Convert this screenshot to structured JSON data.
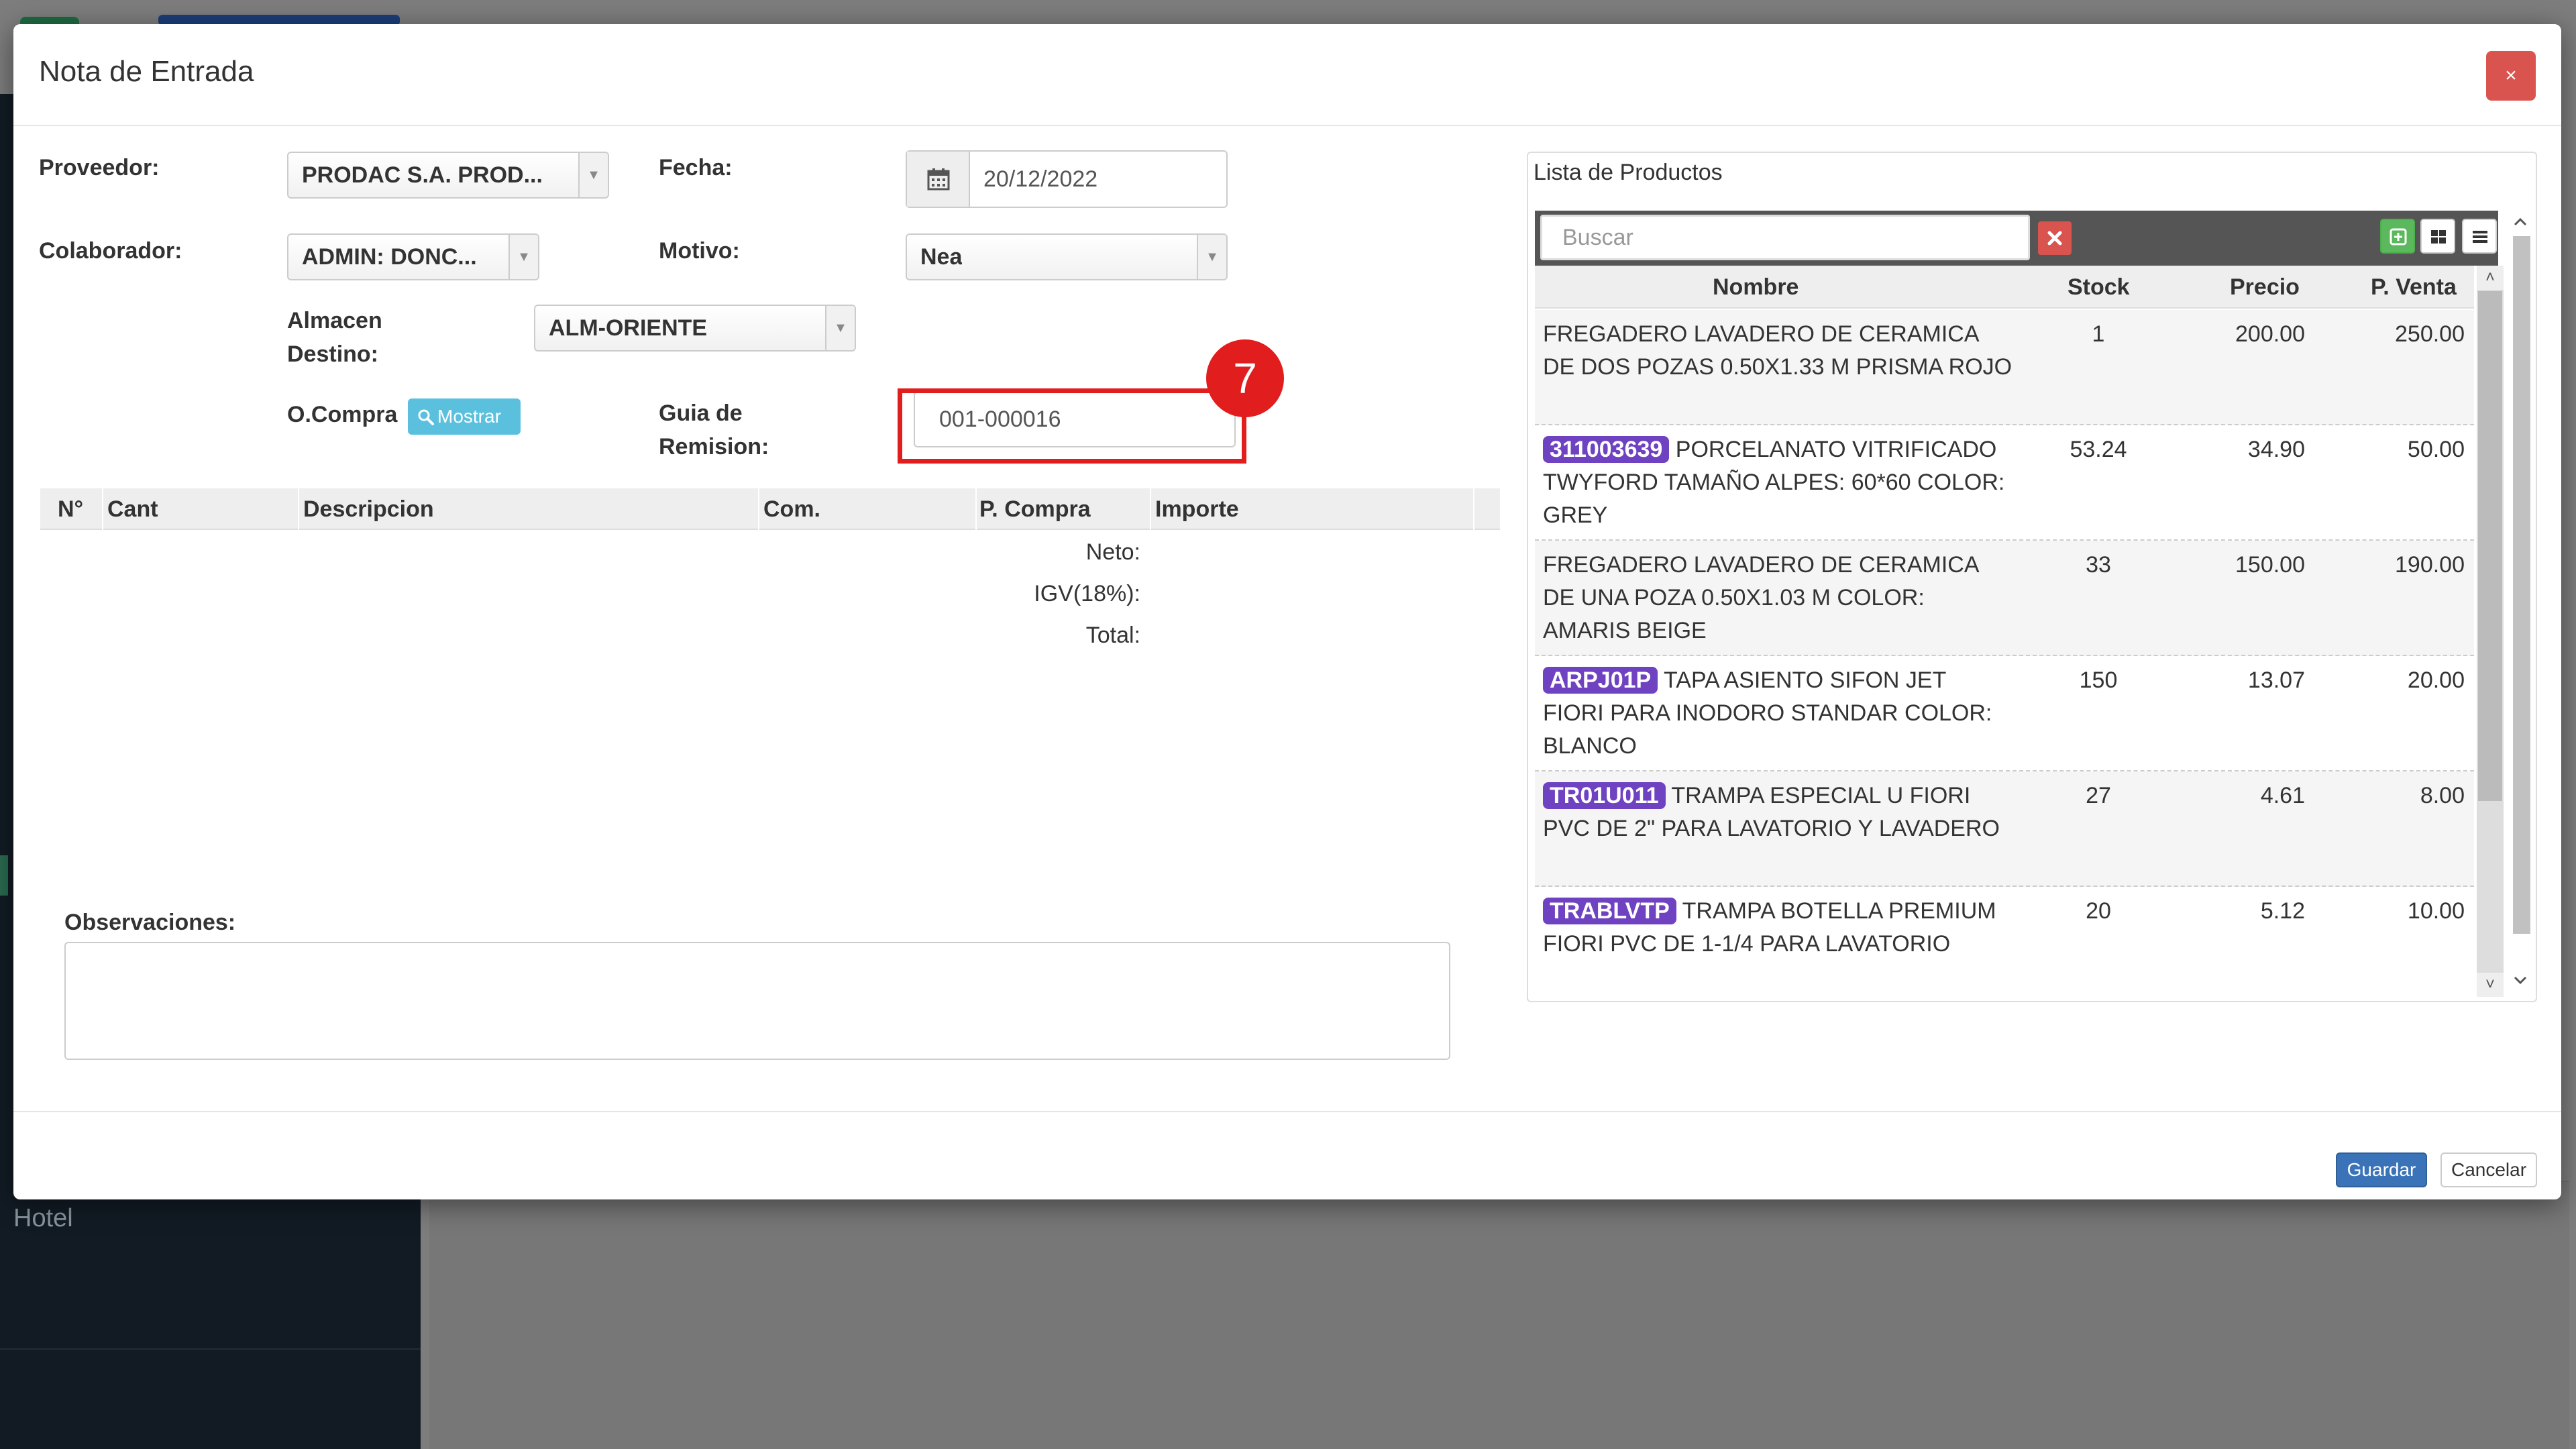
{
  "background": {
    "sidebar_item": "Hotel"
  },
  "modal": {
    "title": "Nota de Entrada",
    "close_label": "×"
  },
  "form": {
    "proveedor": {
      "label": "Proveedor:",
      "value": "PRODAC S.A. PROD..."
    },
    "fecha": {
      "label": "Fecha:",
      "value": "20/12/2022"
    },
    "colaborador": {
      "label": "Colaborador:",
      "value": "ADMIN: DONC..."
    },
    "motivo": {
      "label": "Motivo:",
      "value": "Nea"
    },
    "almacen": {
      "label_line1": "Almacen",
      "label_line2": "Destino:",
      "value": "ALM-ORIENTE"
    },
    "ocompra": {
      "label": "O.Compra",
      "button_label": "Mostrar"
    },
    "guia": {
      "label_line1": "Guia de",
      "label_line2": "Remision:",
      "value": "001-000016"
    },
    "step_badge": "7"
  },
  "items_table": {
    "columns": [
      "N°",
      "Cant",
      "Descripcion",
      "Com.",
      "P. Compra",
      "Importe"
    ],
    "totals": [
      "Neto:",
      "IGV(18%):",
      "Total:"
    ]
  },
  "observaciones": {
    "label": "Observaciones:",
    "value": ""
  },
  "product_list": {
    "title": "Lista de Productos",
    "search_placeholder": "Buscar",
    "columns": [
      "Nombre",
      "Stock",
      "Precio",
      "P. Venta"
    ],
    "rows": [
      {
        "code": "",
        "name": "FREGADERO LAVADERO DE CERAMICA DE DOS POZAS 0.50X1.33 M PRISMA ROJO",
        "stock": "1",
        "precio": "200.00",
        "pventa": "250.00"
      },
      {
        "code": "311003639",
        "name": "PORCELANATO VITRIFICADO TWYFORD TAMAÑO ALPES: 60*60 COLOR: GREY",
        "stock": "53.24",
        "precio": "34.90",
        "pventa": "50.00"
      },
      {
        "code": "",
        "name": "FREGADERO LAVADERO DE CERAMICA DE UNA POZA 0.50X1.03 M COLOR: AMARIS BEIGE",
        "stock": "33",
        "precio": "150.00",
        "pventa": "190.00"
      },
      {
        "code": "ARPJ01P",
        "name": "TAPA ASIENTO SIFON JET FIORI PARA INODORO STANDAR COLOR: BLANCO",
        "stock": "150",
        "precio": "13.07",
        "pventa": "20.00"
      },
      {
        "code": "TR01U011",
        "name": "TRAMPA ESPECIAL U FIORI PVC DE 2\" PARA LAVATORIO Y LAVADERO",
        "stock": "27",
        "precio": "4.61",
        "pventa": "8.00"
      },
      {
        "code": "TRABLVTP",
        "name": "TRAMPA BOTELLA PREMIUM FIORI PVC DE 1-1/4 PARA LAVATORIO",
        "stock": "20",
        "precio": "5.12",
        "pventa": "10.00"
      }
    ]
  },
  "footer": {
    "save_label": "Guardar",
    "cancel_label": "Cancelar"
  },
  "colors": {
    "accent_highlight": "#e11d1d",
    "code_badge": "#6f42c1",
    "primary_button": "#3a73b8",
    "info_button": "#5bc0de",
    "danger_button": "#d9534f"
  }
}
